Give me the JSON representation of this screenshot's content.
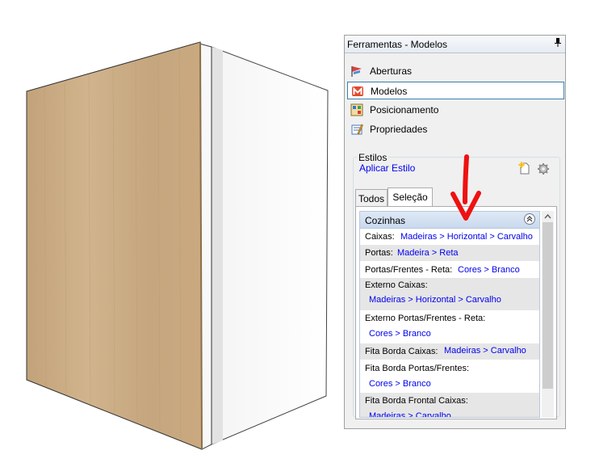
{
  "panel": {
    "title": "Ferramentas - Modelos",
    "pin_glyph": "p"
  },
  "nav": {
    "items": [
      {
        "label": "Aberturas",
        "icon": "openings-flag-icon"
      },
      {
        "label": "Modelos",
        "icon": "models-m-icon",
        "selected": true
      },
      {
        "label": "Posicionamento",
        "icon": "positioning-icon"
      },
      {
        "label": "Propriedades",
        "icon": "properties-icon"
      }
    ]
  },
  "styles": {
    "legend": "Estilos",
    "apply_link": "Aplicar Estilo",
    "tabs": [
      "Todos",
      "Seleção"
    ],
    "active_tab": "Seleção",
    "category": "Cozinhas",
    "rows": [
      {
        "label": "Caixas:",
        "value": "Madeiras > Horizontal > Carvalho"
      },
      {
        "label": "Portas:",
        "value": "Madeira > Reta"
      },
      {
        "label": "Portas/Frentes - Reta:",
        "value": "Cores > Branco"
      },
      {
        "label": "Externo Caixas:",
        "value": "Madeiras > Horizontal > Carvalho"
      },
      {
        "label": "Externo Portas/Frentes - Reta:",
        "value": "Cores > Branco"
      },
      {
        "label": "Fita Borda Caixas:",
        "value": "Madeiras > Carvalho"
      },
      {
        "label": "Fita Borda Portas/Frentes:",
        "value": "Cores > Branco"
      },
      {
        "label": "Fita Borda Frontal Caixas:",
        "value": "Madeiras > Carvalho"
      }
    ]
  },
  "colors": {
    "accent_link": "#0000ee",
    "annotation_arrow": "#ee1111",
    "wood": "#c9aa80"
  }
}
